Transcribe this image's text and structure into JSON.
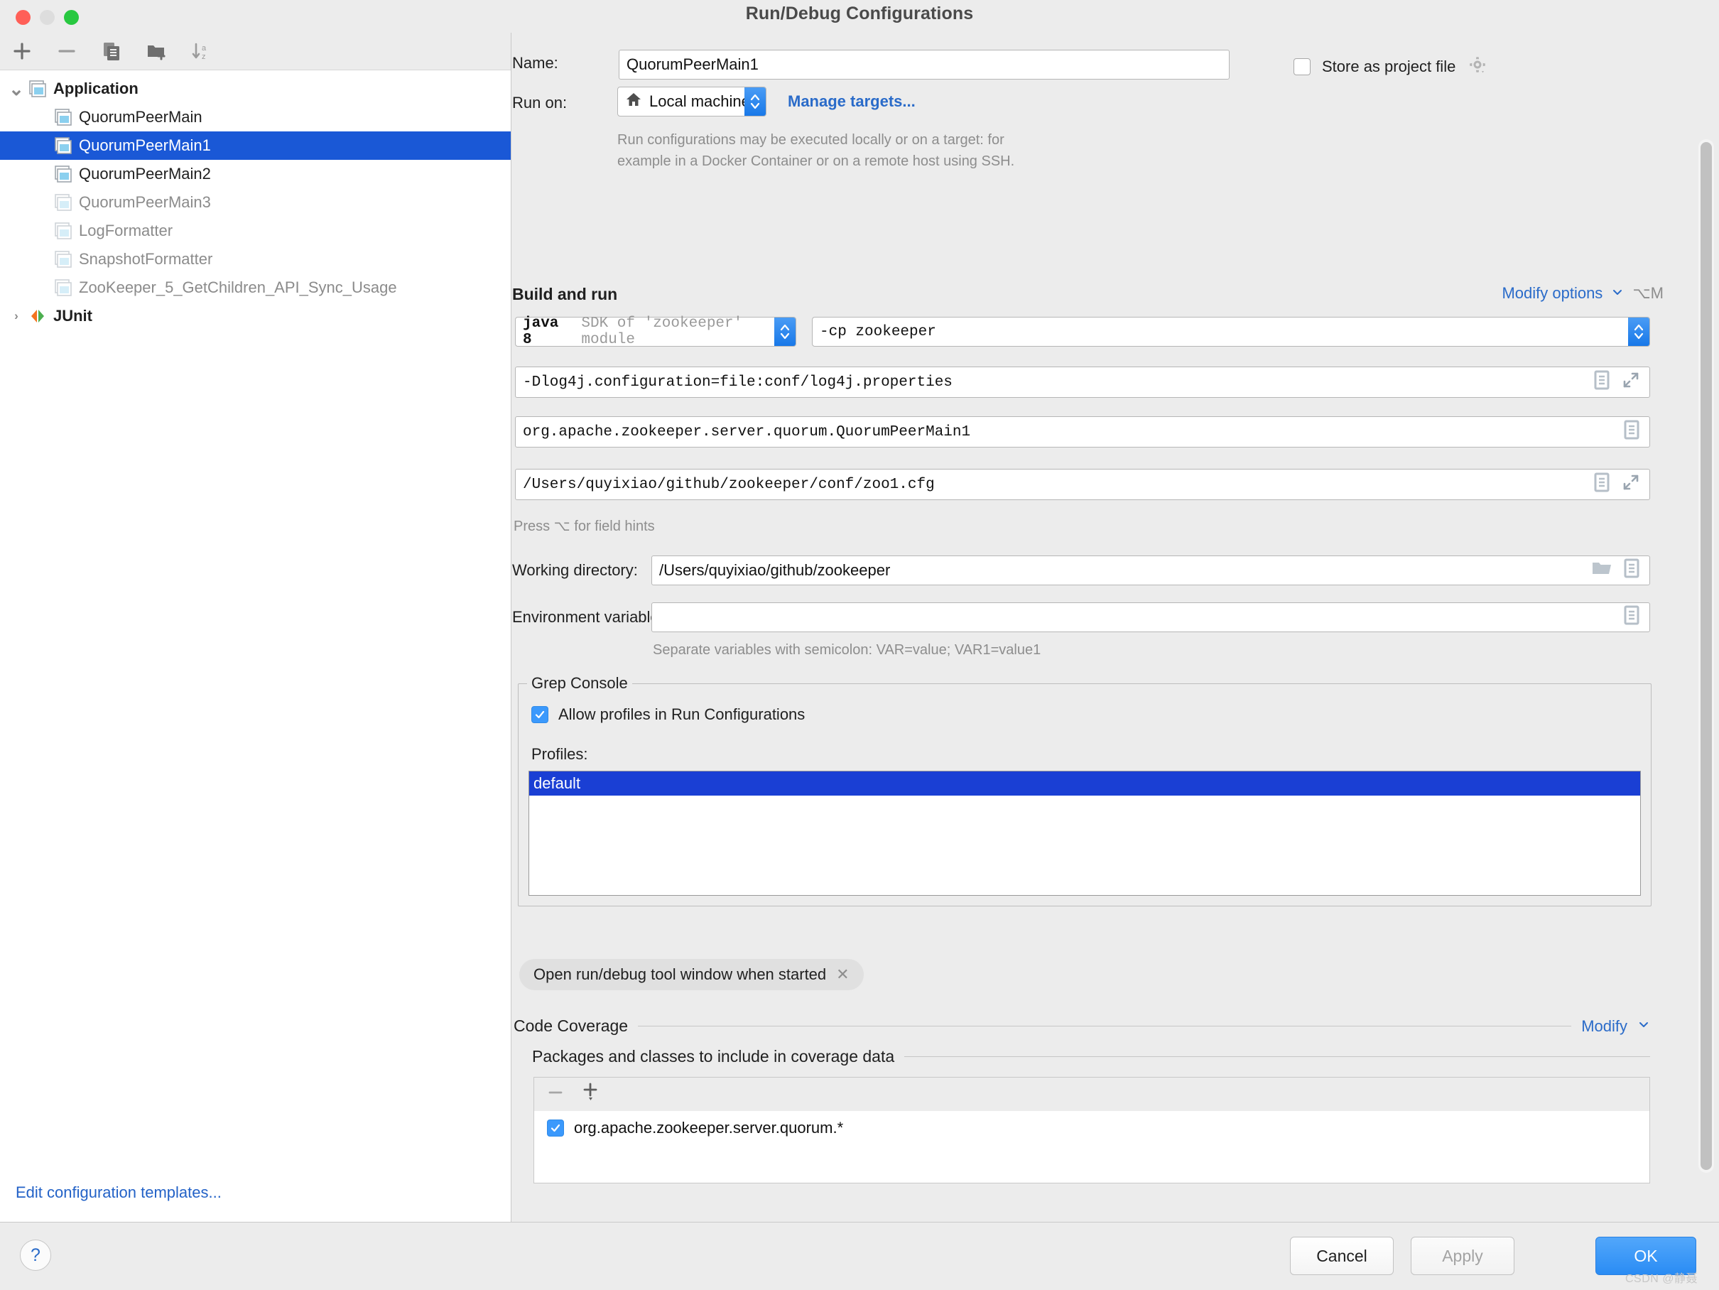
{
  "window": {
    "title": "Run/Debug Configurations",
    "traffic_lights": [
      "close",
      "minimize",
      "zoom"
    ]
  },
  "sidebar": {
    "toolbar": [
      {
        "name": "add-configuration",
        "icon": "plus-icon"
      },
      {
        "name": "remove-configuration",
        "icon": "minus-icon"
      },
      {
        "name": "copy-configuration",
        "icon": "copy-icon"
      },
      {
        "name": "new-folder",
        "icon": "folder-plus-icon"
      },
      {
        "name": "sort-alphabetically",
        "icon": "sort-az-icon"
      }
    ],
    "tree": [
      {
        "label": "Application",
        "level": 0,
        "expanded": true,
        "bold": true,
        "icon": "application-icon",
        "state": "normal"
      },
      {
        "label": "QuorumPeerMain",
        "level": 1,
        "icon": "application-icon",
        "state": "normal"
      },
      {
        "label": "QuorumPeerMain1",
        "level": 1,
        "icon": "application-icon",
        "state": "selected"
      },
      {
        "label": "QuorumPeerMain2",
        "level": 1,
        "icon": "application-icon",
        "state": "normal"
      },
      {
        "label": "QuorumPeerMain3",
        "level": 1,
        "icon": "application-icon",
        "state": "dim"
      },
      {
        "label": "LogFormatter",
        "level": 1,
        "icon": "application-icon",
        "state": "dim"
      },
      {
        "label": "SnapshotFormatter",
        "level": 1,
        "icon": "application-icon",
        "state": "dim"
      },
      {
        "label": "ZooKeeper_5_GetChildren_API_Sync_Usage",
        "level": 1,
        "icon": "application-icon",
        "state": "dim"
      },
      {
        "label": "JUnit",
        "level": 0,
        "expanded": false,
        "bold": true,
        "icon": "junit-icon",
        "state": "normal"
      }
    ],
    "edit_templates_link": "Edit configuration templates..."
  },
  "form": {
    "name_label": "Name:",
    "name_value": "QuorumPeerMain1",
    "store_as_project_file_label": "Store as project file",
    "store_as_project_file_checked": false,
    "store_gear_icon": "gear-icon",
    "run_on_label": "Run on:",
    "run_on_value": "Local machine",
    "run_on_icon": "home-icon",
    "manage_targets_link": "Manage targets...",
    "run_on_description_line1": "Run configurations may be executed locally or on a target: for",
    "run_on_description_line2": "example in a Docker Container or on a remote host using SSH."
  },
  "build_and_run": {
    "section_title": "Build and run",
    "modify_options_link": "Modify options",
    "modify_options_shortcut": "⌥M",
    "jre_value_bold": "java 8",
    "jre_value_gray": "SDK of 'zookeeper' module",
    "classpath_value": "-cp zookeeper",
    "vm_options_value": "-Dlog4j.configuration=file:conf/log4j.properties",
    "main_class_value": "org.apache.zookeeper.server.quorum.QuorumPeerMain1",
    "program_arguments_value": "/Users/quyixiao/github/zookeeper/conf/zoo1.cfg",
    "field_hints_note": "Press ⌥ for field hints"
  },
  "working": {
    "working_directory_label": "Working directory:",
    "working_directory_value": "/Users/quyixiao/github/zookeeper",
    "environment_variables_label": "Environment variables:",
    "environment_variables_value": "",
    "env_note": "Separate variables with semicolon: VAR=value; VAR1=value1"
  },
  "grep_console": {
    "legend": "Grep Console",
    "allow_profiles_label": "Allow profiles in Run Configurations",
    "allow_profiles_checked": true,
    "profiles_label": "Profiles:",
    "profiles": [
      "default"
    ],
    "selected_profile": "default"
  },
  "chips": [
    {
      "label": "Open run/debug tool window when started",
      "close_icon": "close-icon"
    }
  ],
  "code_coverage": {
    "section_title": "Code Coverage",
    "modify_link": "Modify",
    "packages_title": "Packages and classes to include in coverage data",
    "toolbar": [
      {
        "name": "remove-package",
        "icon": "minus-icon"
      },
      {
        "name": "add-package",
        "icon": "plus-dropdown-icon"
      }
    ],
    "items": [
      {
        "label": "org.apache.zookeeper.server.quorum.*",
        "checked": true
      }
    ]
  },
  "footer": {
    "help_label": "?",
    "cancel_label": "Cancel",
    "apply_label": "Apply",
    "ok_label": "OK",
    "watermark": "CSDN @静聂"
  },
  "colors": {
    "accent_blue": "#2a6bc9",
    "selection_blue": "#1a58d6",
    "list_selection_blue": "#1a3fd4",
    "checkbox_blue": "#3b99fc",
    "ok_button_blue": "#2a8cf4",
    "background": "#ececec",
    "panel_white": "#ffffff"
  }
}
